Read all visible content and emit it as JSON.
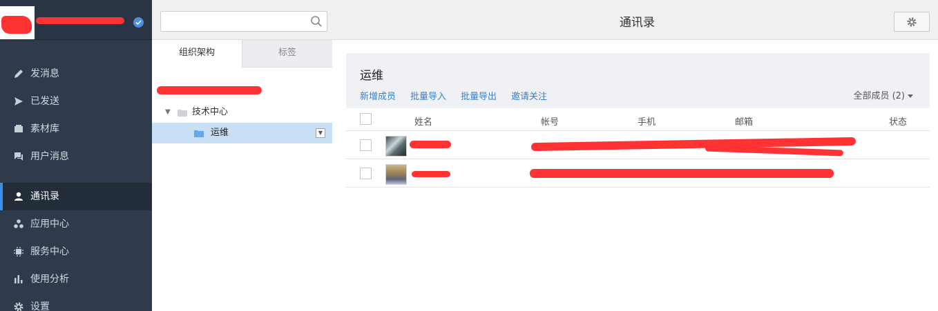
{
  "app": {
    "company_name": "……"
  },
  "sidebar": {
    "items": [
      {
        "label": "发消息",
        "icon": "pencil-icon"
      },
      {
        "label": "已发送",
        "icon": "send-icon"
      },
      {
        "label": "素材库",
        "icon": "folder-icon"
      },
      {
        "label": "用户消息",
        "icon": "chat-icon"
      },
      {
        "label": "通讯录",
        "icon": "user-icon",
        "active": true
      },
      {
        "label": "应用中心",
        "icon": "apps-icon"
      },
      {
        "label": "服务中心",
        "icon": "chip-icon"
      },
      {
        "label": "使用分析",
        "icon": "bar-chart-icon"
      },
      {
        "label": "设置",
        "icon": "gear-icon"
      }
    ]
  },
  "search": {
    "placeholder": "",
    "value": ""
  },
  "header": {
    "title": "通讯录"
  },
  "org_tabs": {
    "org_label": "组织架构",
    "tag_label": "标签",
    "active": "组织架构"
  },
  "tree": {
    "nodes": [
      {
        "label": "技术中心",
        "expanded": true
      },
      {
        "label": "运维",
        "selected": true
      }
    ]
  },
  "department": {
    "title": "运维",
    "actions": [
      "新增成员",
      "批量导入",
      "批量导出",
      "邀请关注"
    ],
    "member_filter": "全部成员 (2)"
  },
  "table": {
    "columns": [
      "姓名",
      "帐号",
      "手机",
      "邮箱",
      "状态"
    ],
    "rows": [
      {
        "name": "",
        "account": "",
        "mobile": "",
        "email": "",
        "status": ""
      },
      {
        "name": "",
        "account": "",
        "mobile": "",
        "email": "",
        "status": ""
      }
    ]
  },
  "colors": {
    "sidebar_bg": "#2f3b4c",
    "accent": "#3e8ee6",
    "link": "#3e7fc6",
    "redaction": "#ff3333"
  }
}
